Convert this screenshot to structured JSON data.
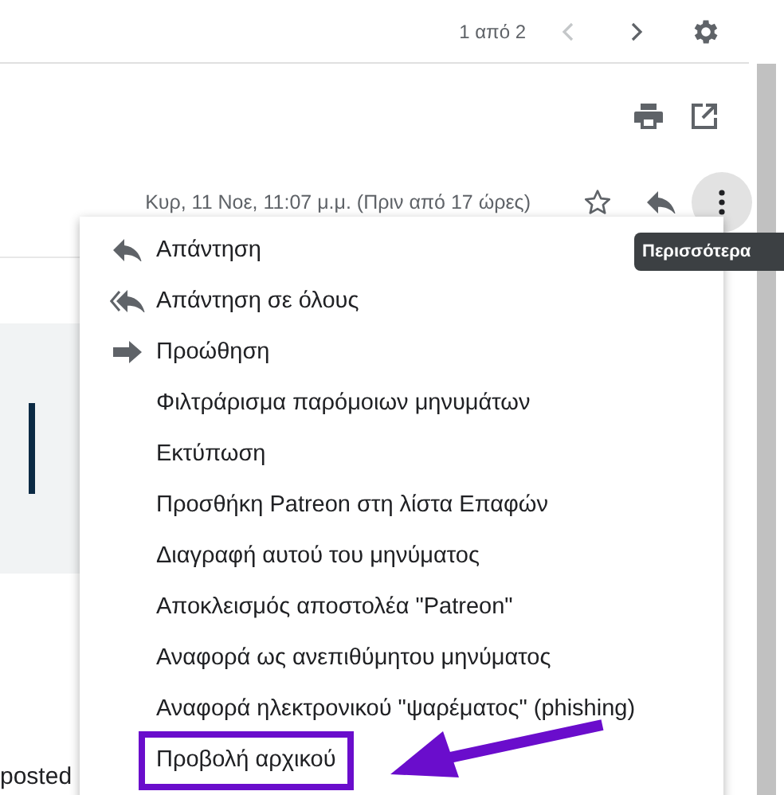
{
  "toolbar": {
    "page_counter": "1 από 2"
  },
  "message": {
    "date": "Κυρ, 11 Νοε, 11:07 μ.μ. (Πριν από 17 ώρες)",
    "starred": false,
    "body_fragment": "posted"
  },
  "tooltip": "Περισσότερα",
  "menu": [
    {
      "label": "Απάντηση",
      "kind": "reply",
      "highlighted": false
    },
    {
      "label": "Απάντηση σε όλους",
      "kind": "reply_all",
      "highlighted": false
    },
    {
      "label": "Προώθηση",
      "kind": "forward",
      "highlighted": false
    },
    {
      "label": "Φιλτράρισμα παρόμοιων μηνυμάτων",
      "kind": "plain",
      "highlighted": false
    },
    {
      "label": "Εκτύπωση",
      "kind": "plain",
      "highlighted": false
    },
    {
      "label": "Προσθήκη Patreon στη λίστα Επαφών",
      "kind": "plain",
      "highlighted": false
    },
    {
      "label": "Διαγραφή αυτού του μηνύματος",
      "kind": "plain",
      "highlighted": false
    },
    {
      "label": "Αποκλεισμός αποστολέα \"Patreon\"",
      "kind": "plain",
      "highlighted": false
    },
    {
      "label": "Αναφορά ως ανεπιθύμητου μηνύματος",
      "kind": "plain",
      "highlighted": false
    },
    {
      "label": "Αναφορά ηλεκτρονικού \"ψαρέματος\" (phishing)",
      "kind": "plain",
      "highlighted": false
    },
    {
      "label": "Προβολή αρχικού",
      "kind": "plain",
      "highlighted": true
    }
  ]
}
